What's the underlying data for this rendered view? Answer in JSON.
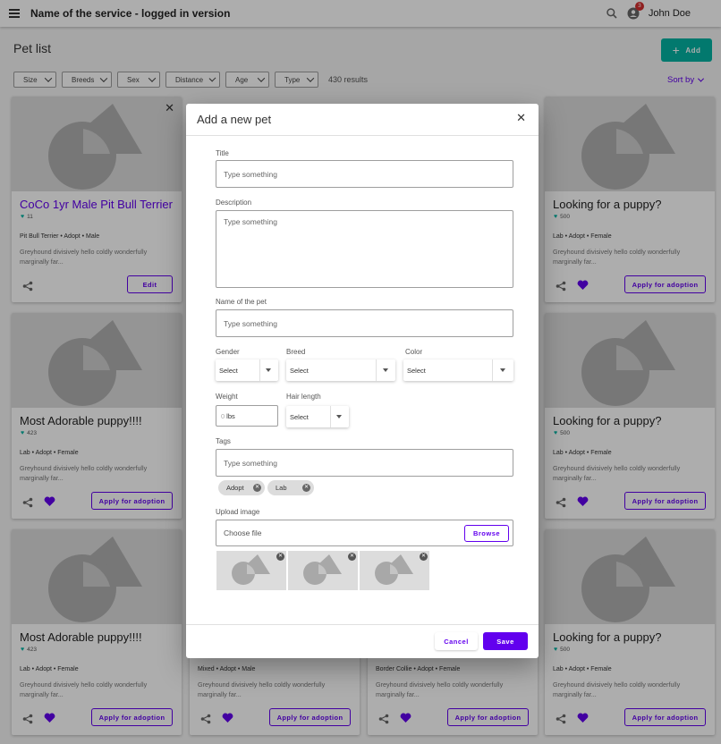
{
  "app": {
    "title": "Name of the service - logged in version",
    "user_name": "John Doe",
    "notification_count": "3"
  },
  "page": {
    "title": "Pet list",
    "add_label": "Add",
    "results": "430 results",
    "sort_label": "Sort by"
  },
  "filters": [
    "Size",
    "Breeds",
    "Sex",
    "Distance",
    "Age",
    "Type"
  ],
  "colors": {
    "accent": "#6200ee",
    "teal": "#03b3a3",
    "placeholder_bg": "#dcdcdc"
  },
  "cards": [
    {
      "title": "CoCo 1yr Male Pit Bull Terrier",
      "likes": "11",
      "meta": "Pit Bull Terrier • Adopt • Male",
      "desc": "Greyhound divisively hello coldly wonderfully marginally far...",
      "button": "Edit",
      "closable": true
    },
    {
      "title": "Looking for a puppy?",
      "likes": "500",
      "meta": "Lab • Adopt • Female",
      "desc": "Greyhound divisively hello coldly wonderfully marginally far...",
      "button": "Apply for adoption"
    },
    {
      "title": "Most Adorable puppy!!!!",
      "likes": "423",
      "meta": "Lab • Adopt • Female",
      "desc": "Greyhound divisively hello coldly wonderfully marginally far...",
      "button": "Apply for adoption"
    },
    {
      "title": "Looking for a puppy?",
      "likes": "500",
      "meta": "Lab • Adopt • Female",
      "desc": "Greyhound divisively hello coldly wonderfully marginally far...",
      "button": "Apply for adoption"
    },
    {
      "title": "Most Adorable puppy!!!!",
      "likes": "423",
      "meta": "Lab • Adopt • Female",
      "desc": "Greyhound divisively hello coldly wonderfully marginally far...",
      "button": "Apply for adoption"
    },
    {
      "title": "",
      "likes": "",
      "meta": "Mixed • Adopt • Male",
      "desc": "Greyhound divisively hello coldly wonderfully marginally far...",
      "button": "Apply for adoption"
    },
    {
      "title": "",
      "likes": "",
      "meta": "Border Collie • Adopt • Female",
      "desc": "Greyhound divisively hello coldly wonderfully marginally far...",
      "button": "Apply for adoption"
    },
    {
      "title": "Looking for a puppy?",
      "likes": "500",
      "meta": "Lab • Adopt • Female",
      "desc": "Greyhound divisively hello coldly wonderfully marginally far...",
      "button": "Apply for adoption"
    }
  ],
  "dialog": {
    "title": "Add a new pet",
    "title_label": "Title",
    "title_placeholder": "Type something",
    "description_label": "Description",
    "description_placeholder": "Type something",
    "pet_name_label": "Name of the pet",
    "pet_name_placeholder": "Type something",
    "gender_label": "Gender",
    "gender_value": "Select",
    "breed_label": "Breed",
    "breed_value": "Select",
    "color_label": "Color",
    "color_value": "Select",
    "weight_label": "Weight",
    "weight_placeholder": "0",
    "weight_unit": "lbs",
    "hair_label": "Hair length",
    "hair_value": "Select",
    "tags_label": "Tags",
    "tags_placeholder": "Type something",
    "tags": [
      "Adopt",
      "Lab"
    ],
    "upload_label": "Upload image",
    "upload_placeholder": "Choose file",
    "browse_label": "Browse",
    "cancel_label": "Cancel",
    "save_label": "Save"
  }
}
